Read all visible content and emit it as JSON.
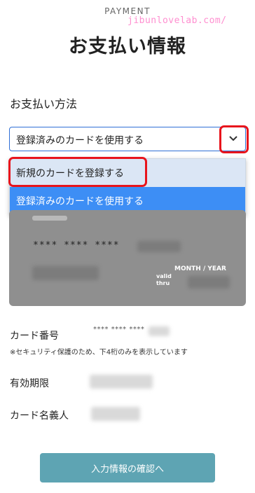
{
  "header": {
    "eyebrow": "PAYMENT",
    "title": "お支払い情報",
    "watermark": "jibunlovelab.com/"
  },
  "payment_method": {
    "label": "お支払い方法",
    "selected": "登録済みのカードを使用する",
    "options": [
      "新規のカードを登録する",
      "登録済みのカードを使用する"
    ],
    "highlighted_option": "登録済みのカードを使用する",
    "annotation_color": "#e8141c"
  },
  "card": {
    "number_masked": "**** **** ****",
    "valid_thru": "valid\nthru",
    "expiry_label": "MONTH / YEAR"
  },
  "details": {
    "card_number_label": "カード番号",
    "card_number_value": "**** **** ****",
    "security_note": "※セキュリティ保護のため、下4桁のみを表示しています",
    "expiry_label": "有効期限",
    "holder_label": "カード名義人"
  },
  "actions": {
    "confirm_label": "入力情報の確認へ",
    "confirm_color": "#5ea4b3"
  }
}
